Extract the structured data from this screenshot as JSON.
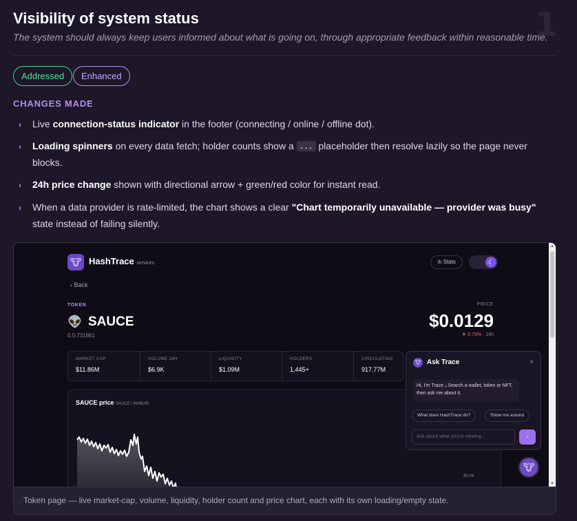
{
  "heuristic": {
    "number": "1",
    "title": "Visibility of system status",
    "subtitle": "The system should always keep users informed about what is going on, through appropriate feedback within reasonable time."
  },
  "tags": {
    "addressed": "Addressed",
    "enhanced": "Enhanced"
  },
  "changes": {
    "heading": "CHANGES MADE",
    "bullet": "›",
    "items": [
      {
        "pre": "Live ",
        "bold": "connection-status indicator",
        "post": " in the footer (connecting / online / offline dot)."
      },
      {
        "pre": "",
        "bold": "Loading spinners",
        "mid": " on every data fetch; holder counts show a ",
        "code": "...",
        "post": " placeholder then resolve lazily so the page never blocks."
      },
      {
        "pre": "",
        "bold": "24h price change",
        "post": " shown with directional arrow + green/red color for instant read."
      },
      {
        "pre": "When a data provider is rate-limited, the chart shows a clear ",
        "bold": "\"Chart temporarily unavailable — provider was busy\"",
        "post": " state instead of failing silently."
      }
    ]
  },
  "screenshot": {
    "brand": {
      "name": "HashTrace",
      "sub": "services"
    },
    "stats_label": "Stats",
    "back_label": "‹  Back",
    "token": {
      "kicker": "TOKEN",
      "name": "SAUCE",
      "id": "0.0.731861",
      "icon": "alien-icon"
    },
    "price": {
      "kicker": "PRICE",
      "value": "$0.0129",
      "change": "▼ 0.79%",
      "period": " · 24h",
      "change_color": "#f25c75"
    },
    "metrics": [
      {
        "label": "MARKET CAP",
        "value": "$11.86M"
      },
      {
        "label": "VOLUME 24H",
        "value": "$6.9K"
      },
      {
        "label": "LIQUIDITY",
        "value": "$1.09M"
      },
      {
        "label": "HOLDERS",
        "value": "1,445+"
      },
      {
        "label": "CIRCULATING",
        "value": "917.77M"
      }
    ],
    "chart": {
      "title": "SAUCE price",
      "pair": "SAUCE / WHBAR",
      "ytick": "$0.04"
    },
    "ask": {
      "title": "Ask Trace",
      "close": "×",
      "message": "Hi, I'm Trace ₒ Search a wallet, token or NFT, then ask me about it.",
      "chips": [
        "What does HashTrace do?",
        "Show me around"
      ],
      "input_placeholder": "Ask about what you're viewing...",
      "send": "▫"
    },
    "caption": "Token page — live market-cap, volume, liquidity, holder count and price chart, each with its own loading/empty state."
  },
  "colors": {
    "accent": "#b48cf2",
    "addressed": "#3ed598",
    "price_down": "#f25c75"
  }
}
